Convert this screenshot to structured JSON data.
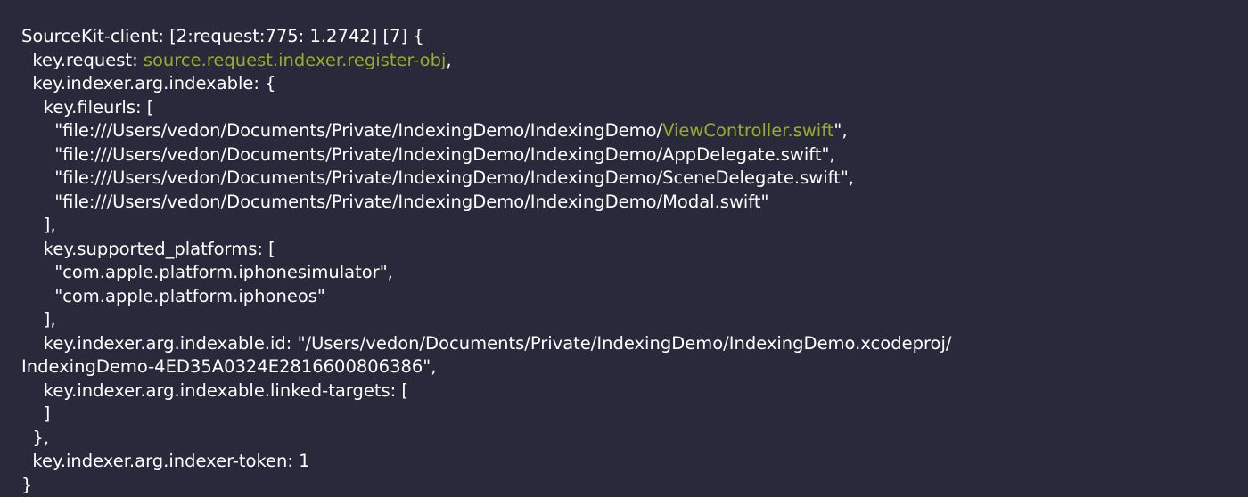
{
  "colors": {
    "background": "#282a3b",
    "text": "#ffffff",
    "highlight": "#9aab2a"
  },
  "log": {
    "line_01": "SourceKit-client: [2:request:775: 1.2742] [7] {",
    "line_02_prefix": "  key.request: ",
    "line_02_value": "source.request.indexer.register-obj",
    "line_02_suffix": ",",
    "line_03": "  key.indexer.arg.indexable: {",
    "line_04": "    key.fileurls: [",
    "line_05_prefix": "      \"file:///Users/vedon/Documents/Private/IndexingDemo/IndexingDemo/",
    "line_05_value": "ViewController.swift",
    "line_05_suffix": "\",",
    "line_06": "      \"file:///Users/vedon/Documents/Private/IndexingDemo/IndexingDemo/AppDelegate.swift\",",
    "line_07": "      \"file:///Users/vedon/Documents/Private/IndexingDemo/IndexingDemo/SceneDelegate.swift\",",
    "line_08": "      \"file:///Users/vedon/Documents/Private/IndexingDemo/IndexingDemo/Modal.swift\"",
    "line_09": "    ],",
    "line_10": "    key.supported_platforms: [",
    "line_11": "      \"com.apple.platform.iphonesimulator\",",
    "line_12": "      \"com.apple.platform.iphoneos\"",
    "line_13": "    ],",
    "line_14": "    key.indexer.arg.indexable.id: \"/Users/vedon/Documents/Private/IndexingDemo/IndexingDemo.xcodeproj/",
    "line_15": "IndexingDemo-4ED35A0324E2816600806386\",",
    "line_16": "    key.indexer.arg.indexable.linked-targets: [",
    "line_17": "    ]",
    "line_18": "  },",
    "line_19": "  key.indexer.arg.indexer-token: 1",
    "line_20": "}"
  }
}
